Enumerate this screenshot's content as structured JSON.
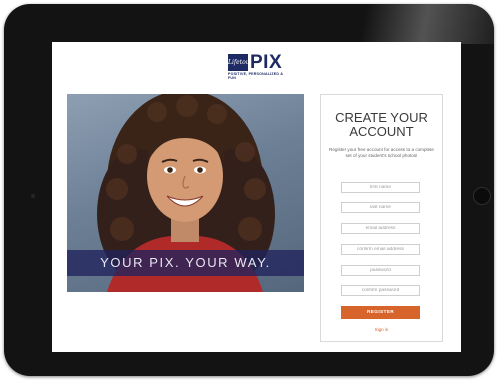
{
  "brand": {
    "badge_text": "Lifetouch",
    "name_main": "PI",
    "name_accent": "X",
    "tagline": "POSITIVE, PERSONALIZED & FUN",
    "color": "#1d2a64"
  },
  "hero": {
    "banner_text": "YOUR PIX. YOUR WAY."
  },
  "form": {
    "title": "CREATE YOUR ACCOUNT",
    "description": "Register your free account for access to a complete set of your student's school photos!",
    "fields": {
      "first_name": "first name",
      "last_name": "last name",
      "email": "email address",
      "confirm_email": "confirm email address",
      "password": "password",
      "confirm_password": "confirm password"
    },
    "register_label": "REGISTER",
    "signin_label": "Sign in",
    "accent_color": "#d7642b"
  },
  "icons": {
    "home_button": "home-button-icon",
    "camera": "camera-icon"
  }
}
